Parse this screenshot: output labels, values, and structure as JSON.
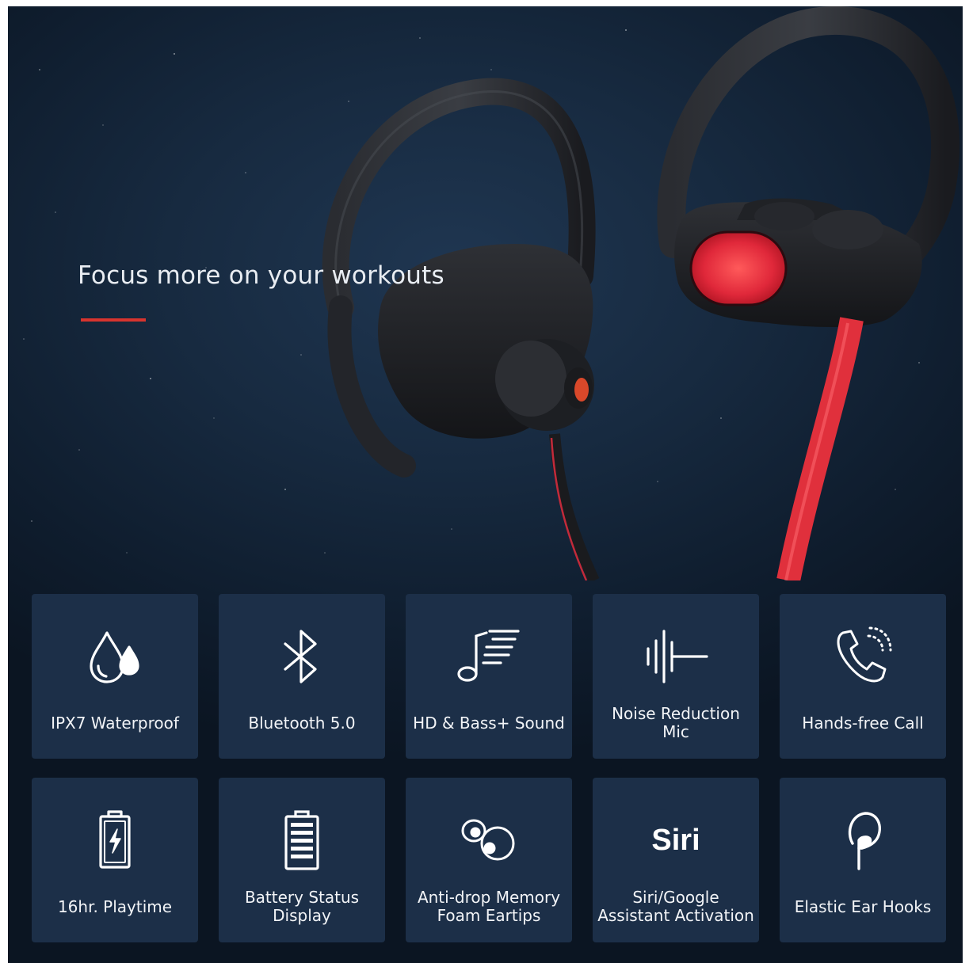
{
  "headline": "Focus more on your workouts",
  "colors": {
    "background": "#132439",
    "tile": "#1c2f48",
    "accent": "#d8342e"
  },
  "features": [
    {
      "label": "IPX7 Waterproof",
      "icon": "water-drops-icon"
    },
    {
      "label": "Bluetooth 5.0",
      "icon": "bluetooth-icon"
    },
    {
      "label": "HD & Bass+ Sound",
      "icon": "music-note-icon"
    },
    {
      "label": "Noise Reduction Mic",
      "icon": "sound-wave-icon"
    },
    {
      "label": "Hands-free Call",
      "icon": "phone-call-icon"
    },
    {
      "label": "16hr. Playtime",
      "icon": "charging-battery-icon"
    },
    {
      "label": "Battery Status Display",
      "icon": "battery-level-icon"
    },
    {
      "label": "Anti-drop Memory Foam Eartips",
      "icon": "eartips-icon"
    },
    {
      "label": "Siri/Google Assistant Activation",
      "icon": "siri-logo",
      "logo_text": "Siri"
    },
    {
      "label": "Elastic Ear Hooks",
      "icon": "ear-hook-icon"
    }
  ]
}
